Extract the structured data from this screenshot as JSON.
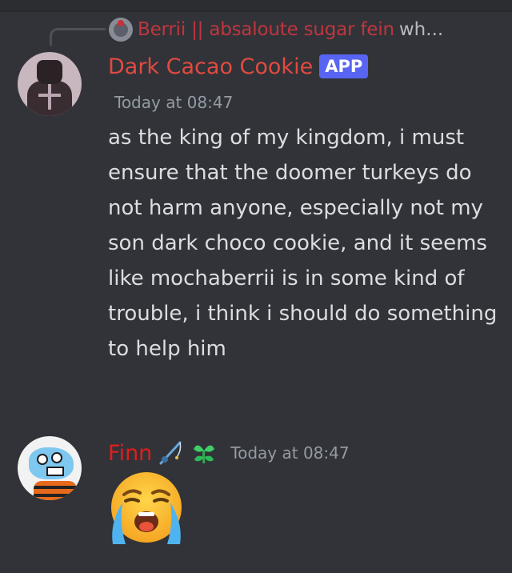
{
  "reply": {
    "author": "Berrii || absaloute sugar fein",
    "snippet": "wh..."
  },
  "messages": [
    {
      "author": "Dark Cacao Cookie",
      "badge": "APP",
      "timestamp": "Today at 08:47",
      "text": "as the king of my kingdom, i must ensure that the doomer turkeys do not harm anyone, especially not my son dark choco cookie, and it seems like mochaberrii is in some kind of trouble, i think i should do something to help him"
    },
    {
      "author": "Finn",
      "timestamp": "Today at 08:47",
      "content_emoji": "loudly-crying-face",
      "name_icons": [
        "fishing-rod-icon",
        "green-leaf-icon"
      ]
    }
  ],
  "colors": {
    "background": "#313338",
    "dark_cacao_name": "#e24a41",
    "finn_name": "#e01e1e",
    "reply_name": "#c0363f",
    "badge": "#5865f2",
    "message_text": "#dbdee1",
    "timestamp": "#949ba4"
  }
}
